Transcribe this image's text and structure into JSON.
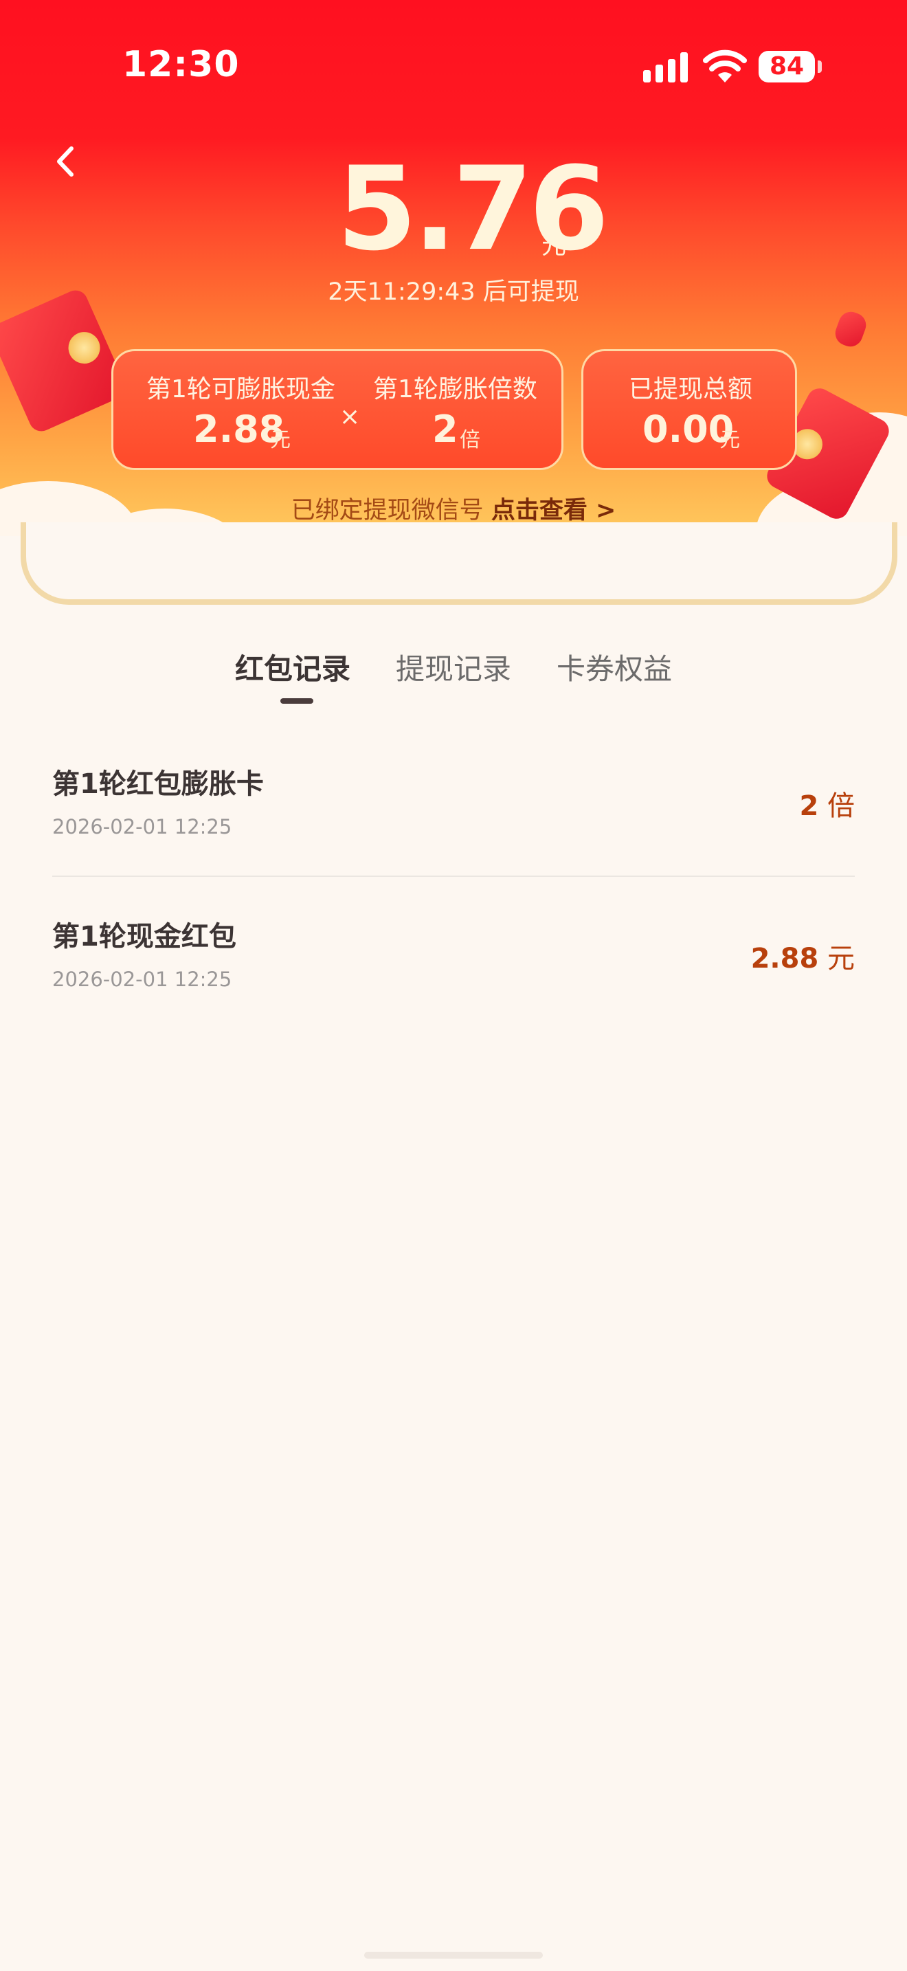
{
  "status_bar": {
    "time": "12:30",
    "battery": "84"
  },
  "header": {
    "amount": "5.76",
    "amount_unit": "元",
    "countdown": "2天11:29:43 后可提现"
  },
  "cards": {
    "round_cash_label": "第1轮可膨胀现金",
    "round_cash_value": "2.88",
    "round_cash_unit": "元",
    "times_symbol": "×",
    "multiplier_label": "第1轮膨胀倍数",
    "multiplier_value": "2",
    "multiplier_unit": "倍",
    "withdrawn_label": "已提现总额",
    "withdrawn_value": "0.00",
    "withdrawn_unit": "元"
  },
  "wechat": {
    "text": "已绑定提现微信号 ",
    "link": "点击查看 >"
  },
  "tabs": [
    {
      "label": "红包记录",
      "active": true
    },
    {
      "label": "提现记录",
      "active": false
    },
    {
      "label": "卡券权益",
      "active": false
    }
  ],
  "records": [
    {
      "title": "第1轮红包膨胀卡",
      "date": "2026-02-01 12:25",
      "value": "2",
      "unit": " 倍"
    },
    {
      "title": "第1轮现金红包",
      "date": "2026-02-01 12:25",
      "value": "2.88",
      "unit": " 元"
    }
  ],
  "colors": {
    "hero_top": "#ff1020",
    "hero_bottom": "#ffd46c",
    "record_value": "#b8400c",
    "page_bg": "#fdf7f1"
  }
}
